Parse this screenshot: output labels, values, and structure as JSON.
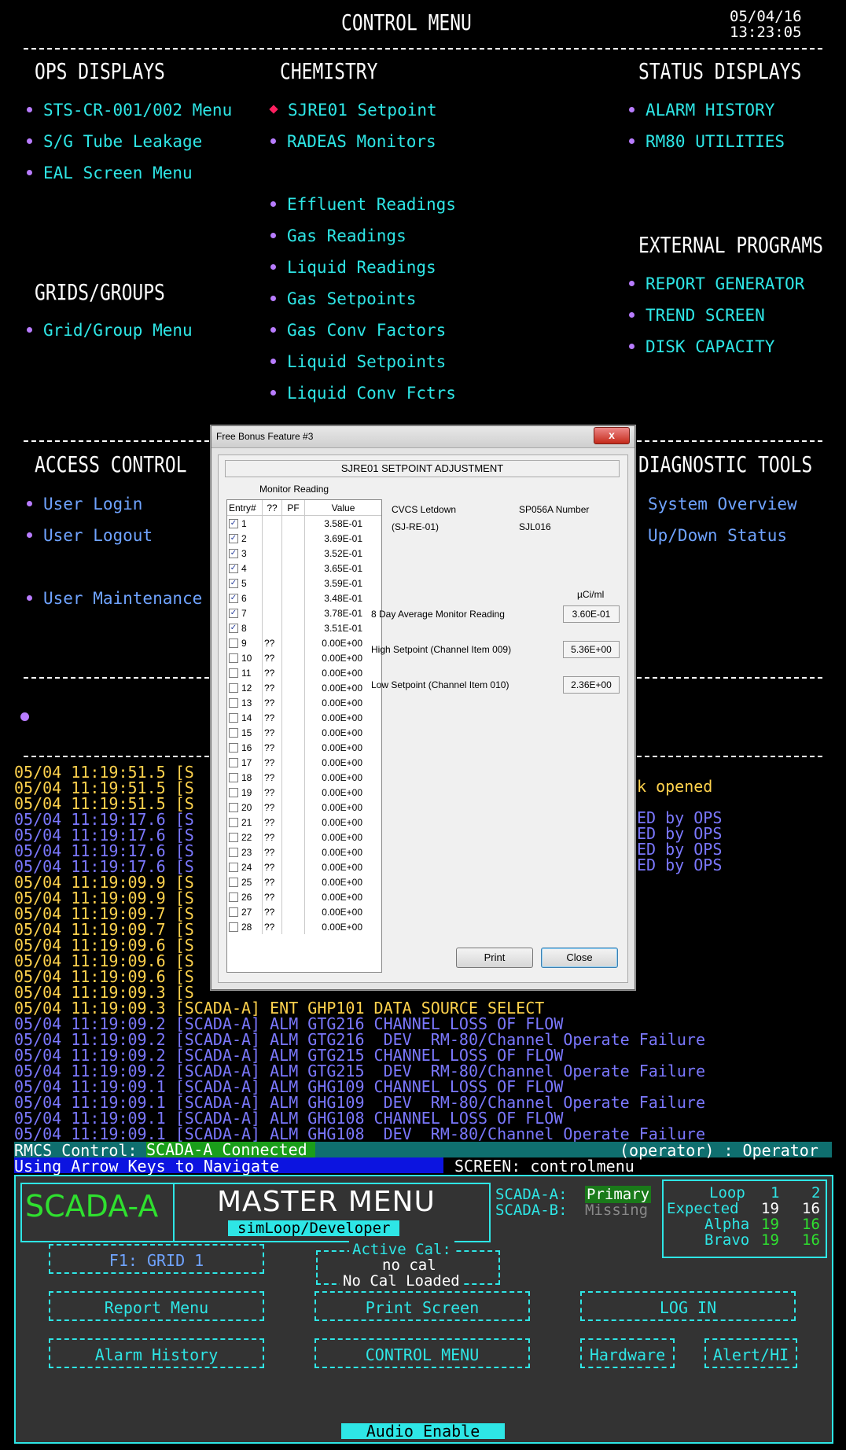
{
  "header": {
    "title": "CONTROL MENU",
    "date": "05/04/16",
    "time": "13:23:05"
  },
  "ops_displays": {
    "heading": "OPS DISPLAYS",
    "items": [
      "STS-CR-001/002 Menu",
      "S/G Tube Leakage",
      "EAL Screen Menu"
    ]
  },
  "chemistry": {
    "heading": "CHEMISTRY",
    "items": [
      "SJRE01 Setpoint",
      "RADEAS Monitors",
      "Effluent Readings",
      "Gas Readings",
      "Liquid Readings",
      "Gas Setpoints",
      "Gas Conv Factors",
      "Liquid Setpoints",
      "Liquid Conv Fctrs"
    ]
  },
  "status_displays": {
    "heading": "STATUS DISPLAYS",
    "items": [
      "ALARM HISTORY",
      "RM80 UTILITIES"
    ]
  },
  "external_programs": {
    "heading": "EXTERNAL PROGRAMS",
    "items": [
      "REPORT GENERATOR",
      "TREND SCREEN",
      "DISK CAPACITY"
    ]
  },
  "grids_groups": {
    "heading": "GRIDS/GROUPS",
    "items": [
      "Grid/Group Menu"
    ]
  },
  "access_control": {
    "heading": "ACCESS CONTROL",
    "items": [
      "User Login",
      "User Logout",
      "User Maintenance"
    ]
  },
  "diagnostic_tools": {
    "heading": "DIAGNOSTIC TOOLS",
    "items": [
      "System Overview",
      "Up/Down Status"
    ]
  },
  "log": {
    "lines": [
      {
        "c": "y",
        "t": "05/04 11:19:51.5 [S"
      },
      {
        "c": "y",
        "t": "05/04 11:19:51.5 [S"
      },
      {
        "c": "y",
        "t": "05/04 11:19:51.5 [S"
      },
      {
        "c": "b",
        "t": "05/04 11:19:17.6 [S"
      },
      {
        "c": "b",
        "t": "05/04 11:19:17.6 [S"
      },
      {
        "c": "b",
        "t": "05/04 11:19:17.6 [S"
      },
      {
        "c": "b",
        "t": "05/04 11:19:17.6 [S"
      },
      {
        "c": "y",
        "t": "05/04 11:19:09.9 [S"
      },
      {
        "c": "y",
        "t": "05/04 11:19:09.9 [S"
      },
      {
        "c": "y",
        "t": "05/04 11:19:09.7 [S"
      },
      {
        "c": "y",
        "t": "05/04 11:19:09.7 [S"
      },
      {
        "c": "y",
        "t": "05/04 11:19:09.6 [S"
      },
      {
        "c": "y",
        "t": "05/04 11:19:09.6 [S"
      },
      {
        "c": "y",
        "t": "05/04 11:19:09.6 [S"
      },
      {
        "c": "y",
        "t": "05/04 11:19:09.3 [S"
      },
      {
        "c": "y",
        "t": "05/04 11:19:09.3 [SCADA-A] ENT GHP101 DATA SOURCE SELECT"
      },
      {
        "c": "b",
        "t": "05/04 11:19:09.2 [SCADA-A] ALM GTG216 CHANNEL LOSS OF FLOW"
      },
      {
        "c": "b",
        "t": "05/04 11:19:09.2 [SCADA-A] ALM GTG216  DEV  RM-80/Channel Operate Failure"
      },
      {
        "c": "b",
        "t": "05/04 11:19:09.2 [SCADA-A] ALM GTG215 CHANNEL LOSS OF FLOW"
      },
      {
        "c": "b",
        "t": "05/04 11:19:09.2 [SCADA-A] ALM GTG215  DEV  RM-80/Channel Operate Failure"
      },
      {
        "c": "b",
        "t": "05/04 11:19:09.1 [SCADA-A] ALM GHG109 CHANNEL LOSS OF FLOW"
      },
      {
        "c": "b",
        "t": "05/04 11:19:09.1 [SCADA-A] ALM GHG109  DEV  RM-80/Channel Operate Failure"
      },
      {
        "c": "b",
        "t": "05/04 11:19:09.1 [SCADA-A] ALM GHG108 CHANNEL LOSS OF FLOW"
      },
      {
        "c": "b",
        "t": "05/04 11:19:09.1 [SCADA-A] ALM GHG108  DEV  RM-80/Channel Operate Failure"
      }
    ],
    "right_fragments": [
      {
        "c": "y",
        "t": "k opened"
      },
      {
        "c": "b",
        "t": "ED by OPS"
      },
      {
        "c": "b",
        "t": "ED by OPS"
      },
      {
        "c": "b",
        "t": "ED by OPS"
      },
      {
        "c": "b",
        "t": "ED by OPS"
      }
    ]
  },
  "statusbar": {
    "rmcs_label": "RMCS Control:",
    "rmcs_value": "SCADA-A Connected",
    "operator": "(operator) : Operator",
    "hint": "Using Arrow Keys to Navigate",
    "screen": "SCREEN: controlmenu"
  },
  "panel": {
    "scada": "SCADA-A",
    "title": "MASTER MENU",
    "subtitle": "simLoop/Developer",
    "scada_a_label": "SCADA-A:",
    "scada_a_value": "Primary",
    "scada_b_label": "SCADA-B:",
    "scada_b_value": "Missing",
    "loop_label": "Loop",
    "loop_1": "1",
    "loop_2": "2",
    "expected_label": "Expected",
    "expected_1": "19",
    "expected_2": "16",
    "alpha_label": "Alpha",
    "alpha_1": "19",
    "alpha_2": "16",
    "bravo_label": "Bravo",
    "bravo_1": "19",
    "bravo_2": "16",
    "f1": "F1:   GRID 1",
    "active_cal_label": "Active Cal:",
    "active_cal_value": "no cal",
    "cal_loaded": "No Cal Loaded",
    "report_menu": "Report  Menu",
    "print_screen": "Print Screen",
    "log_in": "LOG IN",
    "alarm_history": "Alarm  History",
    "control_menu": "CONTROL MENU",
    "hardware": "Hardware",
    "alert": "Alert/HI",
    "audio": "Audio  Enable"
  },
  "dialog": {
    "title": "Free Bonus Feature #3",
    "close_x": "x",
    "heading": "SJRE01 SETPOINT ADJUSTMENT",
    "monitor_reading_label": "Monitor Reading",
    "columns": [
      "Entry#",
      "??",
      "PF",
      "Value"
    ],
    "rows": [
      {
        "n": "1",
        "c": true,
        "q": "",
        "v": "3.58E-01"
      },
      {
        "n": "2",
        "c": true,
        "q": "",
        "v": "3.69E-01"
      },
      {
        "n": "3",
        "c": true,
        "q": "",
        "v": "3.52E-01"
      },
      {
        "n": "4",
        "c": true,
        "q": "",
        "v": "3.65E-01"
      },
      {
        "n": "5",
        "c": true,
        "q": "",
        "v": "3.59E-01"
      },
      {
        "n": "6",
        "c": true,
        "q": "",
        "v": "3.48E-01"
      },
      {
        "n": "7",
        "c": true,
        "q": "",
        "v": "3.78E-01"
      },
      {
        "n": "8",
        "c": true,
        "q": "",
        "v": "3.51E-01"
      },
      {
        "n": "9",
        "c": false,
        "q": "??",
        "v": "0.00E+00"
      },
      {
        "n": "10",
        "c": false,
        "q": "??",
        "v": "0.00E+00"
      },
      {
        "n": "11",
        "c": false,
        "q": "??",
        "v": "0.00E+00"
      },
      {
        "n": "12",
        "c": false,
        "q": "??",
        "v": "0.00E+00"
      },
      {
        "n": "13",
        "c": false,
        "q": "??",
        "v": "0.00E+00"
      },
      {
        "n": "14",
        "c": false,
        "q": "??",
        "v": "0.00E+00"
      },
      {
        "n": "15",
        "c": false,
        "q": "??",
        "v": "0.00E+00"
      },
      {
        "n": "16",
        "c": false,
        "q": "??",
        "v": "0.00E+00"
      },
      {
        "n": "17",
        "c": false,
        "q": "??",
        "v": "0.00E+00"
      },
      {
        "n": "18",
        "c": false,
        "q": "??",
        "v": "0.00E+00"
      },
      {
        "n": "19",
        "c": false,
        "q": "??",
        "v": "0.00E+00"
      },
      {
        "n": "20",
        "c": false,
        "q": "??",
        "v": "0.00E+00"
      },
      {
        "n": "21",
        "c": false,
        "q": "??",
        "v": "0.00E+00"
      },
      {
        "n": "22",
        "c": false,
        "q": "??",
        "v": "0.00E+00"
      },
      {
        "n": "23",
        "c": false,
        "q": "??",
        "v": "0.00E+00"
      },
      {
        "n": "24",
        "c": false,
        "q": "??",
        "v": "0.00E+00"
      },
      {
        "n": "25",
        "c": false,
        "q": "??",
        "v": "0.00E+00"
      },
      {
        "n": "26",
        "c": false,
        "q": "??",
        "v": "0.00E+00"
      },
      {
        "n": "27",
        "c": false,
        "q": "??",
        "v": "0.00E+00"
      },
      {
        "n": "28",
        "c": false,
        "q": "??",
        "v": "0.00E+00"
      }
    ],
    "cvcs_line1": "CVCS Letdown",
    "cvcs_line2": "(SJ-RE-01)",
    "sp_line1": "SP056A Number",
    "sp_line2": "SJL016",
    "unit": "µCi/ml",
    "avg_label": "8 Day Average Monitor Reading",
    "avg_value": "3.60E-01",
    "high_label": "High Setpoint (Channel Item 009)",
    "high_value": "5.36E+00",
    "low_label": "Low Setpoint (Channel Item 010)",
    "low_value": "2.36E+00",
    "print_label": "Print",
    "close_label": "Close"
  }
}
